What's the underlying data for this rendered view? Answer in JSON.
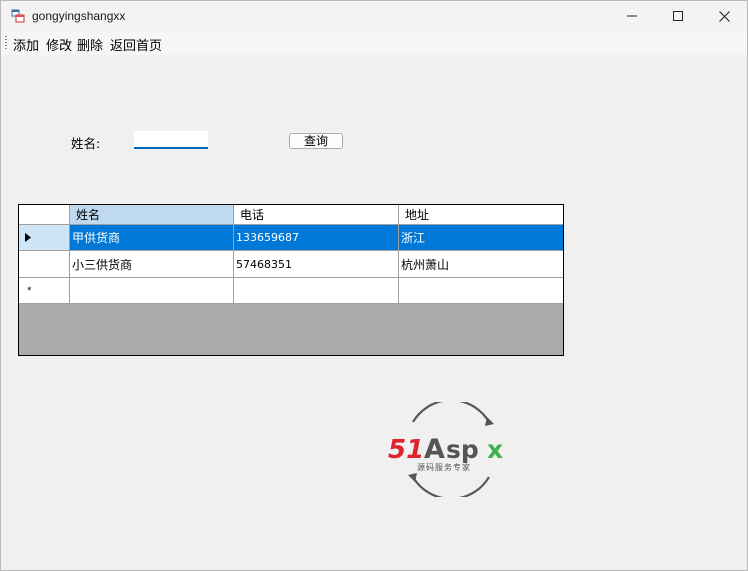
{
  "window": {
    "title": "gongyingshangxx"
  },
  "menu": {
    "items": [
      "添加",
      "修改",
      "删除",
      "返回首页"
    ]
  },
  "search": {
    "label": "姓名:",
    "value": "",
    "button_label": "查询"
  },
  "grid": {
    "columns": [
      "姓名",
      "电话",
      "地址"
    ],
    "rows": [
      {
        "name": "甲供货商",
        "phone": "133659687",
        "address": "浙江",
        "selected": true
      },
      {
        "name": "小三供货商",
        "phone": "57468351",
        "address": "杭州萧山",
        "selected": false
      }
    ],
    "new_row_marker": "*"
  },
  "watermark": {
    "brand_51": "51",
    "brand_a": "A",
    "brand_sp": "sp",
    "brand_x": "x",
    "tagline": "源码服务专家"
  },
  "colors": {
    "selection": "#0078d7",
    "header_selected": "#bed9f0",
    "grid_background": "#ababab",
    "watermark_red": "#e0242d",
    "watermark_green": "#3fb04a"
  }
}
